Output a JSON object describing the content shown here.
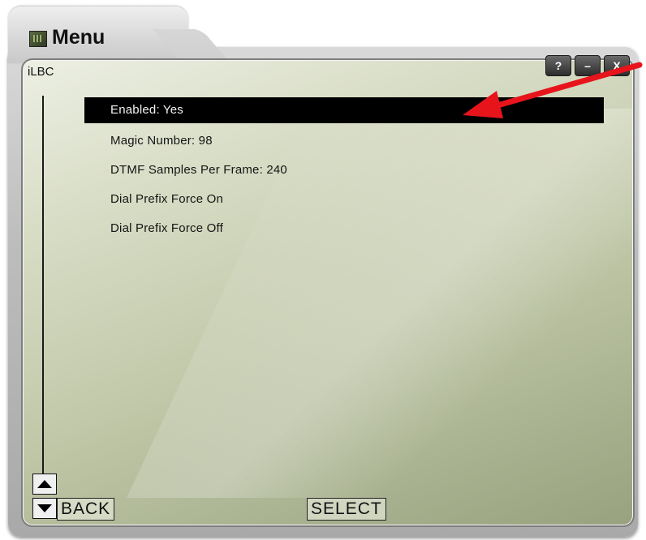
{
  "window": {
    "title": "Menu"
  },
  "panel": {
    "label": "iLBC"
  },
  "menu": {
    "items": [
      {
        "label": "Enabled: Yes",
        "selected": true
      },
      {
        "label": "Magic Number: 98",
        "selected": false
      },
      {
        "label": "DTMF Samples Per Frame: 240",
        "selected": false
      },
      {
        "label": "Dial Prefix Force On",
        "selected": false
      },
      {
        "label": "Dial Prefix Force Off",
        "selected": false
      }
    ]
  },
  "controls": {
    "help_label": "?",
    "minimize_label": "–",
    "close_label": "X",
    "back_label": "BACK",
    "select_label": "SELECT"
  },
  "icons": [
    "menu-icon",
    "arrow-up-icon",
    "arrow-down-icon",
    "annotation-arrow"
  ],
  "colors": {
    "selection": "#000000",
    "panel": "#c2c9aa",
    "annotation": "#e8141c"
  }
}
